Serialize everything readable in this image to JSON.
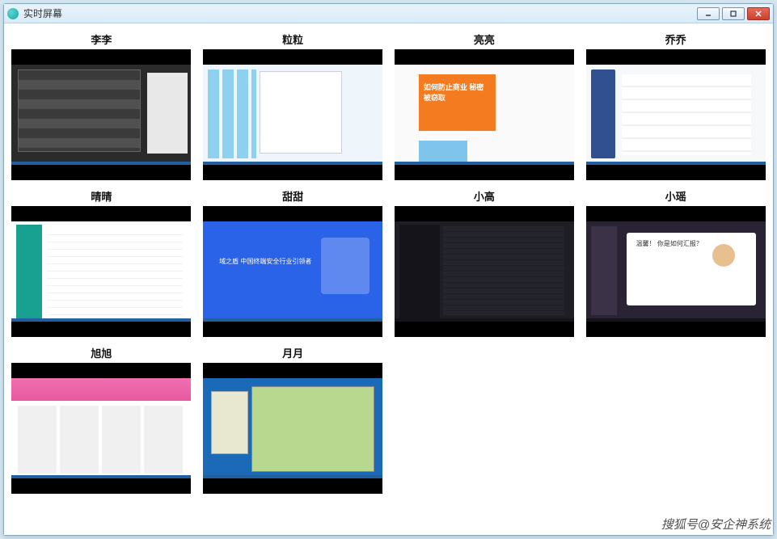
{
  "window": {
    "title": "实时屏幕"
  },
  "controls": {
    "minimize": "—",
    "maximize": "□",
    "close": "✕"
  },
  "screens": [
    {
      "name": "李李"
    },
    {
      "name": "粒粒"
    },
    {
      "name": "亮亮",
      "banner": "如何防止商业\n秘密被窃取"
    },
    {
      "name": "乔乔"
    },
    {
      "name": "晴晴"
    },
    {
      "name": "甜甜",
      "banner": "域之盾 中国终端安全行业引领者"
    },
    {
      "name": "小高"
    },
    {
      "name": "小瑶",
      "banner": "温馨！\n你是如何汇报？"
    },
    {
      "name": "旭旭"
    },
    {
      "name": "月月"
    }
  ],
  "watermark": "搜狐号@安企神系统"
}
